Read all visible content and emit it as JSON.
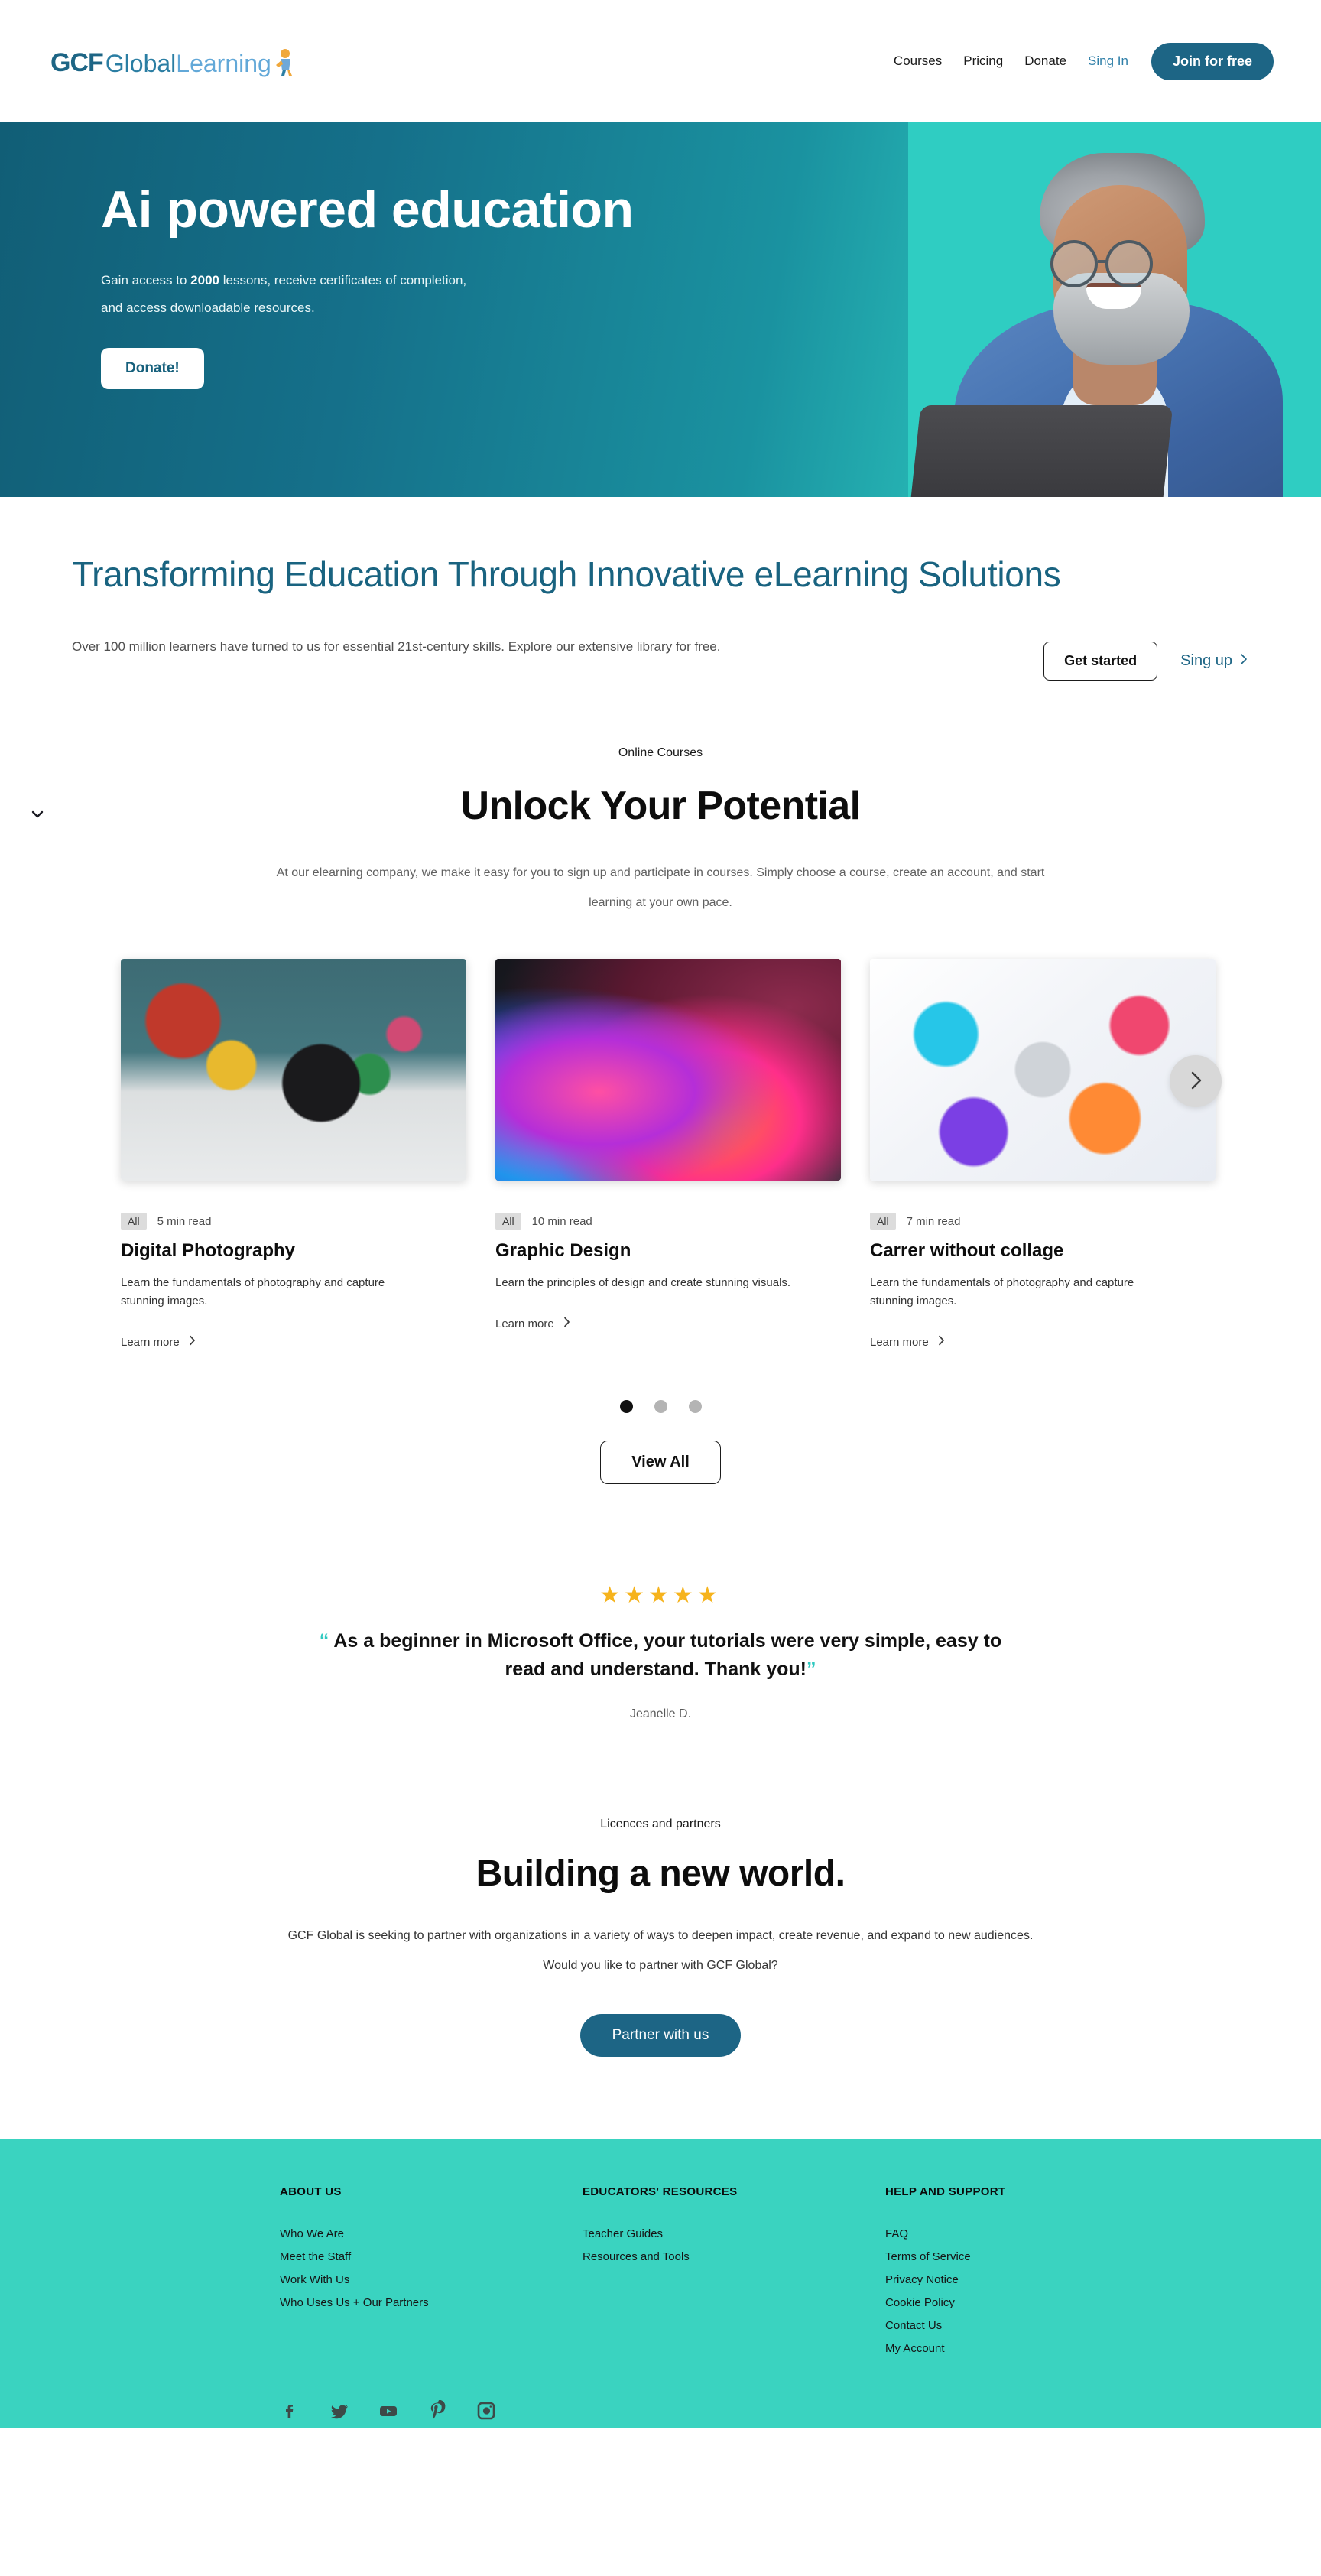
{
  "brand": {
    "logo_gcf": "GCF",
    "logo_global": "Global",
    "logo_learning": "Learning",
    "primary_color": "#1d6585",
    "accent_color": "#3ad3c0"
  },
  "header": {
    "nav": [
      {
        "label": "Courses",
        "kind": "plain"
      },
      {
        "label": "Pricing",
        "kind": "plain"
      },
      {
        "label": "Donate",
        "kind": "plain"
      },
      {
        "label": "Sing In",
        "kind": "signin"
      }
    ],
    "cta_label": "Join for free"
  },
  "hero": {
    "title": "Ai powered education",
    "sub_line1_pre": "Gain access to ",
    "sub_line1_strong": "2000",
    "sub_line1_post": " lessons, receive certificates of completion,",
    "sub_line2": "and access downloadable resources.",
    "button_label": "Donate!"
  },
  "transform": {
    "heading": "Transforming Education Through Innovative eLearning Solutions",
    "copy": "Over 100 million learners have turned to us for essential 21st-century skills. Explore our extensive library for free.",
    "primary_label": "Get started",
    "secondary_label": "Sing up"
  },
  "unlock": {
    "eyebrow": "Online Courses",
    "heading": "Unlock Your Potential",
    "copy": "At our elearning company, we make it easy for you to sign up and participate in courses. Simply choose a course, create an account, and start learning at your own pace.",
    "view_all_label": "View All",
    "dots": [
      {
        "active": true
      },
      {
        "active": false
      },
      {
        "active": false
      }
    ]
  },
  "cards": [
    {
      "tag": "All",
      "read_time": "5 min read",
      "title": "Digital Photography",
      "description": "Learn the fundamentals of photography and capture stunning images.",
      "link_label": "Learn more",
      "image": "camera-with-colorful-blocks-photo"
    },
    {
      "tag": "All",
      "read_time": "10 min read",
      "title": "Graphic Design",
      "description": "Learn the principles of design and create stunning visuals.",
      "link_label": "Learn more",
      "image": "hands-on-laptop-colorful-artwork-photo"
    },
    {
      "tag": "All",
      "read_time": "7 min read",
      "title": "Carrer without collage",
      "description": "Learn the fundamentals of photography and capture stunning images.",
      "link_label": "Learn more",
      "image": "illustration-man-at-laptop-colorful-shapes"
    }
  ],
  "testimonial": {
    "stars": "★★★★★",
    "star_count": 5,
    "open_quote": "“",
    "text": " As a beginner in Microsoft Office, your tutorials were very simple, easy to read and understand. Thank you!",
    "close_quote": "”",
    "author": "Jeanelle D."
  },
  "partners": {
    "eyebrow": "Licences and partners",
    "heading": "Building a new world.",
    "copy": "GCF Global is seeking to partner with organizations in a variety of ways to deepen impact, create revenue, and expand to new audiences. Would you like to partner with GCF Global?",
    "button_label": "Partner with us"
  },
  "footer": {
    "columns": [
      {
        "title": "ABOUT US",
        "links": [
          "Who We Are",
          "Meet the Staff",
          "Work With Us",
          "Who Uses Us + Our Partners"
        ]
      },
      {
        "title": "EDUCATORS' RESOURCES",
        "links": [
          "Teacher Guides",
          "Resources and Tools"
        ]
      },
      {
        "title": "HELP AND SUPPORT",
        "links": [
          "FAQ",
          "Terms of Service",
          "Privacy Notice",
          "Cookie Policy",
          "Contact Us",
          "My Account"
        ]
      }
    ],
    "socials": [
      "facebook-icon",
      "twitter-icon",
      "youtube-icon",
      "pinterest-icon",
      "instagram-icon"
    ]
  }
}
